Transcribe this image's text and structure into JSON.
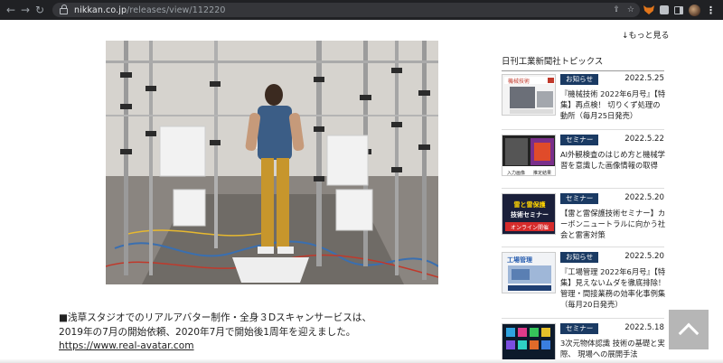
{
  "browser": {
    "url_host": "nikkan.co.jp",
    "url_path": "/releases/view/112220"
  },
  "article": {
    "caption_line1": "■浅草スタジオでのリアルアバター制作・全身３Dスキャンサービスは、",
    "caption_line2": "2019年の7月の開始依頼、2020年7月で開始後1周年を迎えました。",
    "link": "https://www.real-avatar.com"
  },
  "sidebar": {
    "more_label": "↓もっと見る",
    "title": "日刊工業新聞社トピックス",
    "items": [
      {
        "tag": "お知らせ",
        "date": "2022.5.25",
        "headline": "『機械技術 2022年6月号』【特集】再点検！ 切りくず処理の動所（毎月25日発売）"
      },
      {
        "tag": "セミナー",
        "date": "2022.5.22",
        "headline": "AI外観検査のはじめ方と機械学習を意識した画像情報の取得"
      },
      {
        "tag": "セミナー",
        "date": "2022.5.20",
        "headline": "【雷と雷保護技術セミナー】カーボンニュートラルに向かう社会と雷害対策"
      },
      {
        "tag": "お知らせ",
        "date": "2022.5.20",
        "headline": "『工場管理 2022年6月号』【特集】見えないムダを徹底排除！ 管理・間接業務の効率化事例集（毎月20日発売）"
      },
      {
        "tag": "セミナー",
        "date": "2022.5.18",
        "headline": "3次元物体認識 技術の基礎と実際、 現場への展開手法"
      }
    ]
  },
  "thumbnails": {
    "t1_label": "機械技術",
    "t2_label1": "入力画像",
    "t2_label2": "推定結果",
    "t3_line1": "雷と雷保護",
    "t3_line2": "技術セミナー",
    "t3_line3": "オンライン開催",
    "t4_label": "工場管理"
  }
}
